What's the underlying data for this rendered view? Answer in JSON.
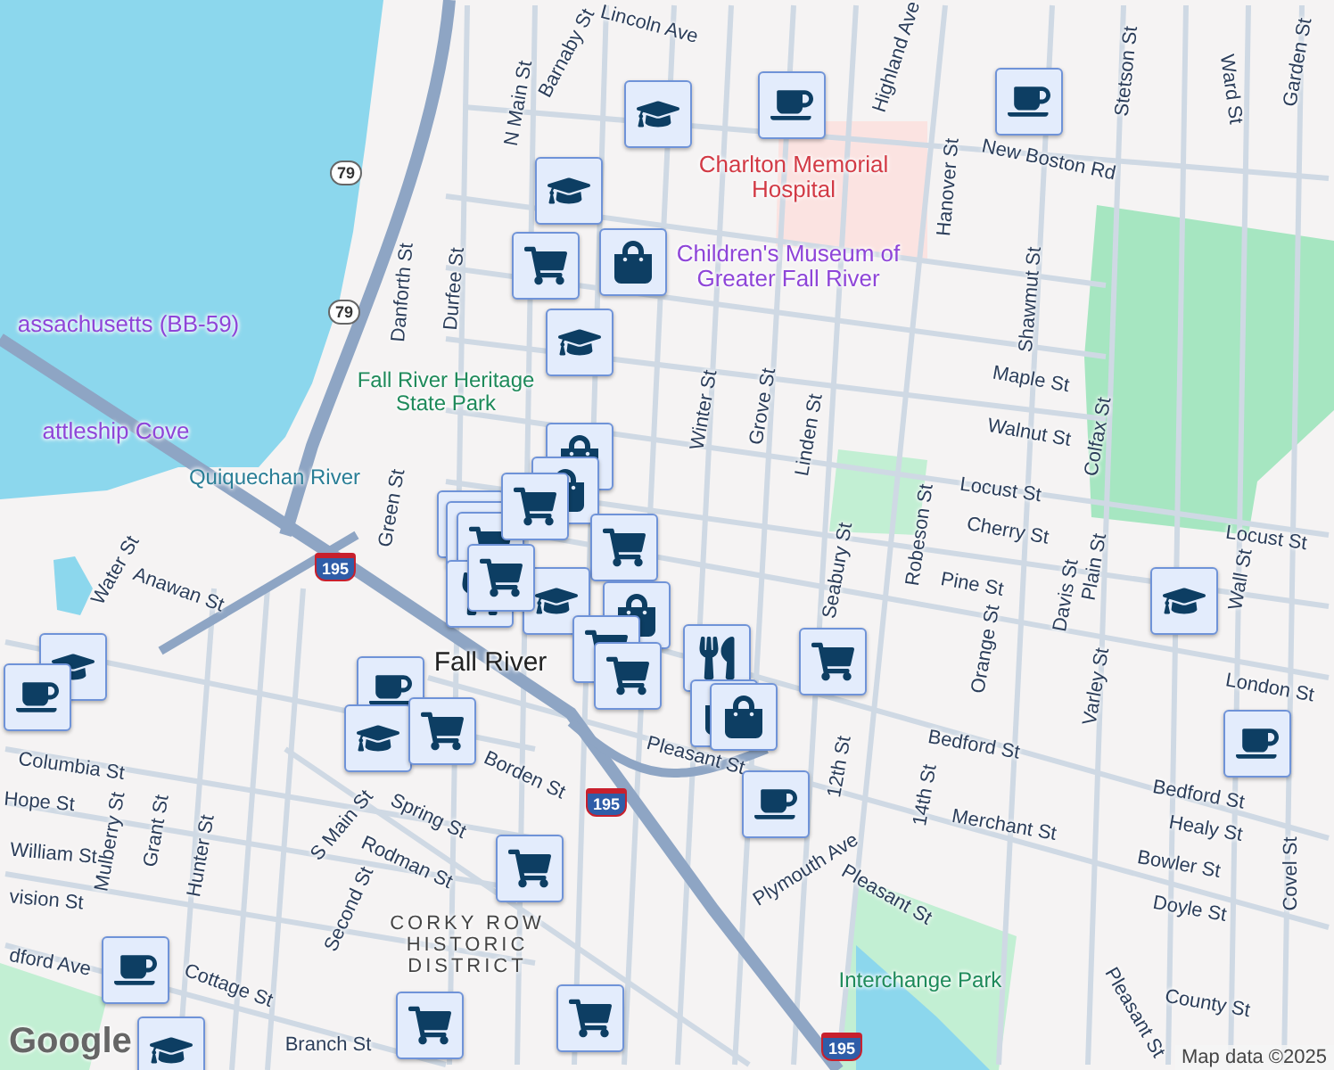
{
  "map": {
    "labels": [
      {
        "text": "Lincoln Ave",
        "kind": "street"
      },
      {
        "text": "Barnaby St",
        "kind": "street"
      },
      {
        "text": "N Main St",
        "kind": "street"
      },
      {
        "text": "Highland Ave",
        "kind": "street"
      },
      {
        "text": "Stetson St",
        "kind": "street"
      },
      {
        "text": "Ward St",
        "kind": "street"
      },
      {
        "text": "Garden St",
        "kind": "street"
      },
      {
        "text": "New Boston Rd",
        "kind": "street"
      },
      {
        "text": "Hanover St",
        "kind": "street"
      },
      {
        "text": "Shawmut St",
        "kind": "street"
      },
      {
        "text": "Maple St",
        "kind": "street"
      },
      {
        "text": "Walnut St",
        "kind": "street"
      },
      {
        "text": "Colfax St",
        "kind": "street"
      },
      {
        "text": "Locust St",
        "kind": "street"
      },
      {
        "text": "Locust St",
        "kind": "street"
      },
      {
        "text": "Winter St",
        "kind": "street"
      },
      {
        "text": "Grove St",
        "kind": "street"
      },
      {
        "text": "Linden St",
        "kind": "street"
      },
      {
        "text": "Cherry St",
        "kind": "street"
      },
      {
        "text": "Pine St",
        "kind": "street"
      },
      {
        "text": "Robeson St",
        "kind": "street"
      },
      {
        "text": "Orange St",
        "kind": "street"
      },
      {
        "text": "Davis St",
        "kind": "street"
      },
      {
        "text": "Plain St",
        "kind": "street"
      },
      {
        "text": "Varley St",
        "kind": "street"
      },
      {
        "text": "Wall St",
        "kind": "street"
      },
      {
        "text": "London St",
        "kind": "street"
      },
      {
        "text": "Bedford St",
        "kind": "street"
      },
      {
        "text": "Bedford St",
        "kind": "street"
      },
      {
        "text": "Healy St",
        "kind": "street"
      },
      {
        "text": "Merchant St",
        "kind": "street"
      },
      {
        "text": "Bowler St",
        "kind": "street"
      },
      {
        "text": "Doyle St",
        "kind": "street"
      },
      {
        "text": "Covel St",
        "kind": "street"
      },
      {
        "text": "County St",
        "kind": "street"
      },
      {
        "text": "Pleasant St",
        "kind": "street"
      },
      {
        "text": "Pleasant St",
        "kind": "street"
      },
      {
        "text": "Pleasant St",
        "kind": "street"
      },
      {
        "text": "Plymouth Ave",
        "kind": "street"
      },
      {
        "text": "12th St",
        "kind": "street"
      },
      {
        "text": "14th St",
        "kind": "street"
      },
      {
        "text": "Seabury St",
        "kind": "street"
      },
      {
        "text": "Danforth St",
        "kind": "street"
      },
      {
        "text": "Durfee St",
        "kind": "street"
      },
      {
        "text": "Green St",
        "kind": "street"
      },
      {
        "text": "Water St",
        "kind": "street"
      },
      {
        "text": "Anawan St",
        "kind": "street"
      },
      {
        "text": "Columbia St",
        "kind": "street"
      },
      {
        "text": "Hope St",
        "kind": "street"
      },
      {
        "text": "William St",
        "kind": "street"
      },
      {
        "text": "vision St",
        "kind": "street"
      },
      {
        "text": "dford Ave",
        "kind": "street"
      },
      {
        "text": "Mulberry St",
        "kind": "street"
      },
      {
        "text": "Grant St",
        "kind": "street"
      },
      {
        "text": "Hunter St",
        "kind": "street"
      },
      {
        "text": "S Main St",
        "kind": "street"
      },
      {
        "text": "Spring St",
        "kind": "street"
      },
      {
        "text": "Borden St",
        "kind": "street"
      },
      {
        "text": "Rodman St",
        "kind": "street"
      },
      {
        "text": "Second St",
        "kind": "street"
      },
      {
        "text": "Cottage St",
        "kind": "street"
      },
      {
        "text": "Branch St",
        "kind": "street"
      },
      {
        "text": "Charlton Memorial Hospital",
        "kind": "hospital"
      },
      {
        "text": "Children's Museum of Greater Fall River",
        "kind": "attraction"
      },
      {
        "text": "assachusetts (BB-59)",
        "kind": "attraction"
      },
      {
        "text": "attleship Cove",
        "kind": "attraction"
      },
      {
        "text": "Fall River Heritage State Park",
        "kind": "park"
      },
      {
        "text": "Interchange Park",
        "kind": "park"
      },
      {
        "text": "Quiquechan River",
        "kind": "water"
      },
      {
        "text": "Fall River",
        "kind": "city"
      },
      {
        "text": "CORKY ROW HISTORIC DISTRICT",
        "kind": "district"
      },
      {
        "text": "79",
        "kind": "state-route"
      },
      {
        "text": "79",
        "kind": "state-route"
      },
      {
        "text": "195",
        "kind": "interstate"
      },
      {
        "text": "195",
        "kind": "interstate"
      },
      {
        "text": "195",
        "kind": "interstate"
      }
    ],
    "markers": [
      {
        "kind": "school"
      },
      {
        "kind": "coffee"
      },
      {
        "kind": "coffee"
      },
      {
        "kind": "school"
      },
      {
        "kind": "grocery"
      },
      {
        "kind": "shopping"
      },
      {
        "kind": "school"
      },
      {
        "kind": "shopping"
      },
      {
        "kind": "shopping"
      },
      {
        "kind": "grocery"
      },
      {
        "kind": "grocery"
      },
      {
        "kind": "grocery"
      },
      {
        "kind": "grocery"
      },
      {
        "kind": "grocery"
      },
      {
        "kind": "school"
      },
      {
        "kind": "restaurant"
      },
      {
        "kind": "shopping"
      },
      {
        "kind": "grocery"
      },
      {
        "kind": "grocery"
      },
      {
        "kind": "restaurant"
      },
      {
        "kind": "shopping"
      },
      {
        "kind": "shopping"
      },
      {
        "kind": "grocery"
      },
      {
        "kind": "school"
      },
      {
        "kind": "coffee"
      },
      {
        "kind": "coffee"
      },
      {
        "kind": "grocery"
      },
      {
        "kind": "coffee"
      },
      {
        "kind": "school"
      },
      {
        "kind": "grocery"
      },
      {
        "kind": "school"
      },
      {
        "kind": "coffee"
      },
      {
        "kind": "grocery"
      },
      {
        "kind": "coffee"
      },
      {
        "kind": "school"
      },
      {
        "kind": "grocery"
      },
      {
        "kind": "grocery"
      }
    ],
    "attribution": {
      "logo": "Google",
      "text": "Map data ©2025"
    }
  }
}
